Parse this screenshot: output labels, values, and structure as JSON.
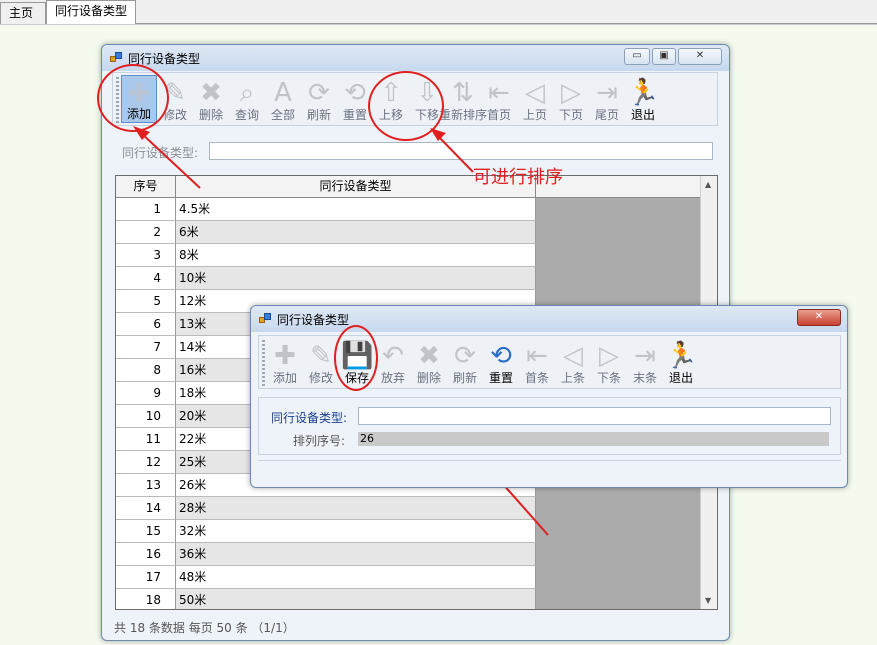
{
  "tabs": [
    {
      "label": "主页",
      "active": false
    },
    {
      "label": "同行设备类型",
      "active": true
    }
  ],
  "main_window": {
    "title": "同行设备类型",
    "toolbar": [
      {
        "label": "添加",
        "icon": "plus-icon",
        "enabled": true,
        "selected": true
      },
      {
        "label": "修改",
        "icon": "edit-icon",
        "enabled": false
      },
      {
        "label": "删除",
        "icon": "delete-icon",
        "enabled": false
      },
      {
        "label": "查询",
        "icon": "search-icon",
        "enabled": false
      },
      {
        "label": "全部",
        "icon": "all-icon",
        "enabled": false
      },
      {
        "label": "刷新",
        "icon": "refresh-icon",
        "enabled": false
      },
      {
        "label": "重置",
        "icon": "reset-icon",
        "enabled": false
      },
      {
        "label": "上移",
        "icon": "arrow-up-icon",
        "enabled": false
      },
      {
        "label": "下移",
        "icon": "arrow-down-icon",
        "enabled": false
      },
      {
        "label": "重新排序",
        "icon": "resort-icon",
        "enabled": false
      },
      {
        "label": "首页",
        "icon": "first-page-icon",
        "enabled": false
      },
      {
        "label": "上页",
        "icon": "prev-page-icon",
        "enabled": false
      },
      {
        "label": "下页",
        "icon": "next-page-icon",
        "enabled": false
      },
      {
        "label": "尾页",
        "icon": "last-page-icon",
        "enabled": false
      },
      {
        "label": "退出",
        "icon": "exit-icon",
        "enabled": true
      }
    ],
    "search_label": "同行设备类型:",
    "search_value": "",
    "grid": {
      "headers": [
        "序号",
        "同行设备类型"
      ],
      "rows": [
        [
          "1",
          "4.5米"
        ],
        [
          "2",
          "6米"
        ],
        [
          "3",
          "8米"
        ],
        [
          "4",
          "10米"
        ],
        [
          "5",
          "12米"
        ],
        [
          "6",
          "13米"
        ],
        [
          "7",
          "14米"
        ],
        [
          "8",
          "16米"
        ],
        [
          "9",
          "18米"
        ],
        [
          "10",
          "20米"
        ],
        [
          "11",
          "22米"
        ],
        [
          "12",
          "25米"
        ],
        [
          "13",
          "26米"
        ],
        [
          "14",
          "28米"
        ],
        [
          "15",
          "32米"
        ],
        [
          "16",
          "36米"
        ],
        [
          "17",
          "48米"
        ],
        [
          "18",
          "50米"
        ]
      ]
    },
    "status": "共 18 条数据 每页 50 条 （1/1）"
  },
  "annotation": "可进行排序",
  "dialog": {
    "title": "同行设备类型",
    "toolbar": [
      {
        "label": "添加",
        "icon": "plus-icon",
        "enabled": false
      },
      {
        "label": "修改",
        "icon": "edit-icon",
        "enabled": false
      },
      {
        "label": "保存",
        "icon": "save-icon",
        "enabled": true
      },
      {
        "label": "放弃",
        "icon": "undo-icon",
        "enabled": false
      },
      {
        "label": "删除",
        "icon": "delete-icon",
        "enabled": false
      },
      {
        "label": "刷新",
        "icon": "refresh-icon",
        "enabled": false
      },
      {
        "label": "重置",
        "icon": "reset-icon",
        "enabled": true
      },
      {
        "label": "首条",
        "icon": "first-record-icon",
        "enabled": false
      },
      {
        "label": "上条",
        "icon": "prev-record-icon",
        "enabled": false
      },
      {
        "label": "下条",
        "icon": "next-record-icon",
        "enabled": false
      },
      {
        "label": "末条",
        "icon": "last-record-icon",
        "enabled": false
      },
      {
        "label": "退出",
        "icon": "exit-icon",
        "enabled": true
      }
    ],
    "type_label": "同行设备类型:",
    "type_value": "",
    "order_label": "排列序号:",
    "order_value": "26"
  },
  "colors": {
    "accent": "#e02020",
    "selected": "#a9c8ec",
    "grid_bg": "#ababab"
  }
}
